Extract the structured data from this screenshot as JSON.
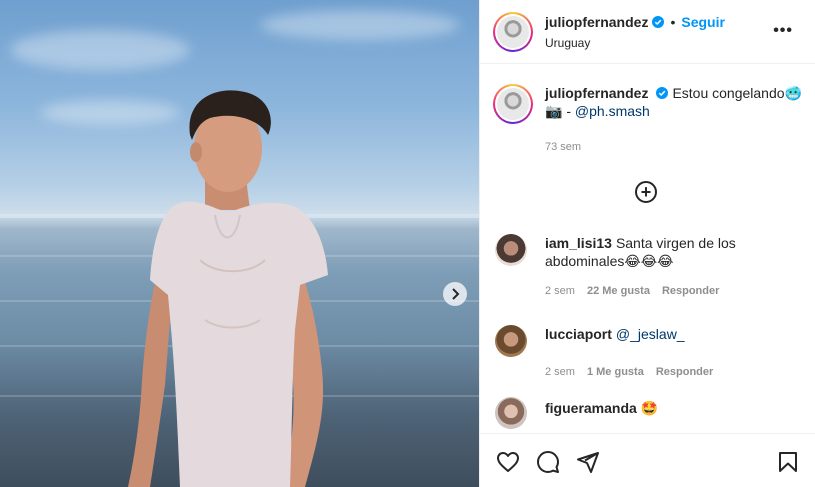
{
  "post": {
    "author": {
      "username": "juliopfernandez",
      "location": "Uruguay"
    },
    "header": {
      "separator": "•",
      "follow_label": "Seguir",
      "more_label": "•••"
    },
    "caption": {
      "username": "juliopfernandez",
      "text": "Estou congelando🥶",
      "camera_emoji": "📷",
      "dash": "-",
      "mention": "@ph.smash",
      "time": "73 sem"
    },
    "load_more_label": "+",
    "comments": [
      {
        "username": "iam_lisi13",
        "text": "Santa virgen de los abdominales😂😂😂",
        "time": "2 sem",
        "likes": "22 Me gusta",
        "reply": "Responder"
      },
      {
        "username": "lucciaport",
        "text": "@_jeslaw_",
        "time": "2 sem",
        "likes": "1 Me gusta",
        "reply": "Responder"
      },
      {
        "username": "figueramanda",
        "text": "🤩"
      }
    ],
    "icons": {
      "verified": "verified-badge-icon",
      "next": "chevron-right-icon",
      "like": "heart-icon",
      "comment": "comment-bubble-icon",
      "share": "paper-plane-icon",
      "save": "bookmark-icon",
      "more": "more-options-icon",
      "load_more": "plus-circle-icon"
    },
    "colors": {
      "accent": "#0095f6",
      "verified": "#0095f6",
      "text": "#262626",
      "muted": "#8e8e8e",
      "mention": "#00376b"
    }
  }
}
